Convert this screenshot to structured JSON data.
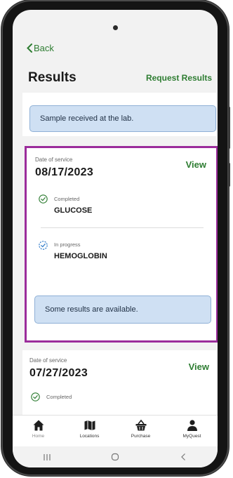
{
  "header": {
    "back_label": "Back",
    "title": "Results",
    "request_label": "Request Results"
  },
  "top_card": {
    "message": "Sample received at the lab."
  },
  "main_card": {
    "date_label": "Date of service",
    "date": "08/17/2023",
    "view_label": "View",
    "tests": [
      {
        "status": "Completed",
        "name": "GLUCOSE",
        "icon": "check-circle-icon"
      },
      {
        "status": "In progress",
        "name": "HEMOGLOBIN",
        "icon": "progress-circle-icon"
      }
    ],
    "message": "Some results are available."
  },
  "second_card": {
    "date_label": "Date of service",
    "date": "07/27/2023",
    "view_label": "View",
    "tests": [
      {
        "status": "Completed",
        "icon": "check-circle-icon"
      }
    ]
  },
  "tabbar": {
    "items": [
      {
        "label": "Home",
        "icon": "home-icon"
      },
      {
        "label": "Locations",
        "icon": "map-icon"
      },
      {
        "label": "Purchase",
        "icon": "basket-icon"
      },
      {
        "label": "MyQuest",
        "icon": "person-icon"
      }
    ]
  },
  "colors": {
    "accent_green": "#2e7d32",
    "info_blue": "#cfe0f3",
    "highlight_border": "#9b2c9b"
  }
}
